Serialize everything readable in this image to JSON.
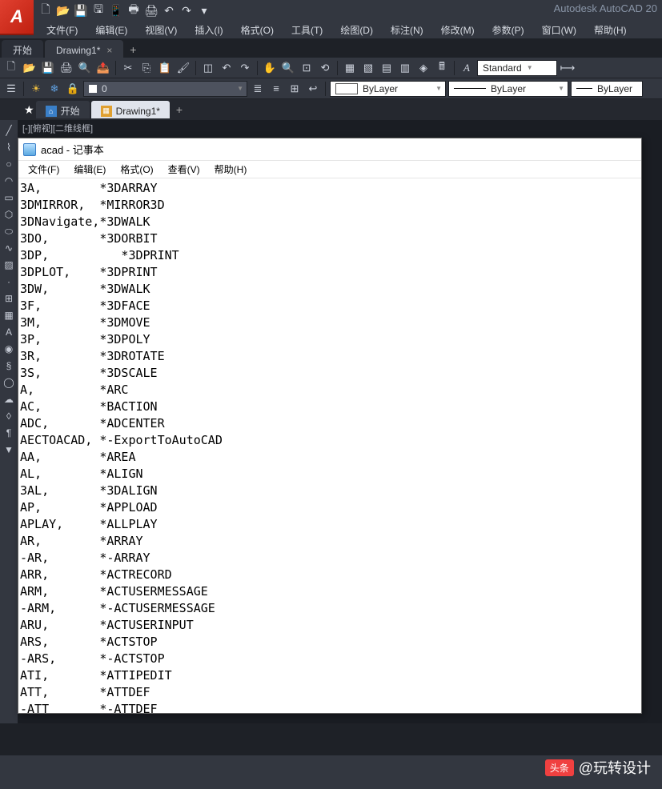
{
  "app": {
    "title": "Autodesk AutoCAD 20",
    "logo_text": "A"
  },
  "menus": [
    "文件(F)",
    "编辑(E)",
    "视图(V)",
    "插入(I)",
    "格式(O)",
    "工具(T)",
    "绘图(D)",
    "标注(N)",
    "修改(M)",
    "参数(P)",
    "窗口(W)",
    "帮助(H)"
  ],
  "doc_tabs": {
    "tab1": "开始",
    "tab2": "Drawing1*"
  },
  "layer_controls": {
    "layer_value": "0",
    "bylayer1": "ByLayer",
    "bylayer2": "ByLayer",
    "bylayer3": "ByLayer",
    "standard": "Standard"
  },
  "nav_tabs": {
    "home": "开始",
    "drawing": "Drawing1*"
  },
  "viewport_label": "[-][俯视][二维线框]",
  "notepad": {
    "title": "acad - 记事本",
    "menus": [
      "文件(F)",
      "编辑(E)",
      "格式(O)",
      "查看(V)",
      "帮助(H)"
    ],
    "content": "3A,        *3DARRAY\n3DMIRROR,  *MIRROR3D\n3DNavigate,*3DWALK\n3DO,       *3DORBIT\n3DP,          *3DPRINT\n3DPLOT,    *3DPRINT\n3DW,       *3DWALK\n3F,        *3DFACE\n3M,        *3DMOVE\n3P,        *3DPOLY\n3R,        *3DROTATE\n3S,        *3DSCALE\nA,         *ARC\nAC,        *BACTION\nADC,       *ADCENTER\nAECTOACAD, *-ExportToAutoCAD\nAA,        *AREA\nAL,        *ALIGN\n3AL,       *3DALIGN\nAP,        *APPLOAD\nAPLAY,     *ALLPLAY\nAR,        *ARRAY\n-AR,       *-ARRAY\nARR,       *ACTRECORD\nARM,       *ACTUSERMESSAGE\n-ARM,      *-ACTUSERMESSAGE\nARU,       *ACTUSERINPUT\nARS,       *ACTSTOP\n-ARS,      *-ACTSTOP\nATI,       *ATTIPEDIT\nATT,       *ATTDEF\n-ATT       *-ATTDEF"
  },
  "watermark": {
    "badge": "头条",
    "text": "@玩转设计"
  }
}
